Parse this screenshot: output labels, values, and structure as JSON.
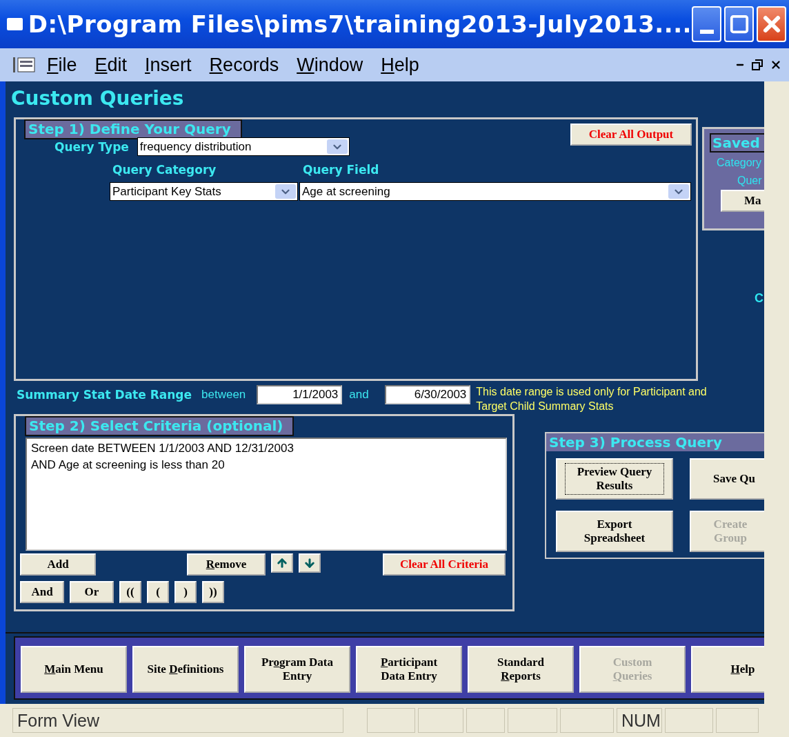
{
  "window": {
    "title": "D:\\Program Files\\pims7\\training2013-July2013...."
  },
  "menu": [
    {
      "access_key": "F",
      "rest": "ile"
    },
    {
      "access_key": "E",
      "rest": "dit"
    },
    {
      "access_key": "I",
      "rest": "nsert"
    },
    {
      "access_key": "R",
      "rest": "ecords"
    },
    {
      "access_key": "W",
      "rest": "indow"
    },
    {
      "access_key": "H",
      "rest": "elp"
    }
  ],
  "heading": "Custom Queries",
  "step1": {
    "title": "Step 1) Define Your Query",
    "clear_button": "Clear All Output",
    "query_type": {
      "label": "Query Type",
      "value": "frequency distribution"
    },
    "query_category": {
      "label": "Query Category",
      "value": "Participant Key Stats"
    },
    "query_field": {
      "label": "Query Field",
      "value": "Age at screening"
    }
  },
  "saved": {
    "title": "Saved",
    "category_label": "Category",
    "query_label": "Quer",
    "button": "Ma",
    "side_text": "C"
  },
  "date_range": {
    "label": "Summary Stat Date Range",
    "between": "between",
    "from": "1/1/2003",
    "and": "and",
    "to": "6/30/2003",
    "note": "This date range is used only for Participant and Target Child Summary Stats"
  },
  "step2": {
    "title": "Step 2) Select Criteria (optional)",
    "criteria": [
      "Screen date BETWEEN 1/1/2003 AND 12/31/2003",
      "AND Age at screening is less than 20"
    ],
    "add_button": "Add",
    "remove_button": {
      "access_key": "R",
      "rest": "emove"
    },
    "clear_button": "Clear All Criteria",
    "operators": [
      "And",
      "Or",
      "((",
      "(",
      ")",
      "))"
    ]
  },
  "step3": {
    "title": "Step 3) Process Query",
    "buttons": [
      {
        "label": "Preview Query Results",
        "focused": true,
        "disabled": false
      },
      {
        "label": "Save Qu",
        "focused": false,
        "disabled": false
      },
      {
        "label": "Export Spreadsheet",
        "focused": false,
        "disabled": false
      },
      {
        "label": "Create Group",
        "focused": false,
        "disabled": true
      }
    ]
  },
  "nav": [
    {
      "access_key": "M",
      "rest": "ain Menu",
      "disabled": false
    },
    {
      "before": "Site ",
      "access_key": "D",
      "rest": "efinitions",
      "disabled": false
    },
    {
      "before": "Pr",
      "access_key": "o",
      "rest": "gram  Data Entry",
      "disabled": false
    },
    {
      "access_key": "P",
      "rest": "articipant Data Entry",
      "disabled": false
    },
    {
      "before": "Standard ",
      "access_key": "R",
      "rest": "eports",
      "disabled": false
    },
    {
      "before": "Custom ",
      "access_key": "Q",
      "rest": "ueries",
      "disabled": true
    },
    {
      "access_key": "H",
      "rest": "elp",
      "disabled": false
    }
  ],
  "status_bar": {
    "mode": "Form View",
    "num": "NUM"
  }
}
